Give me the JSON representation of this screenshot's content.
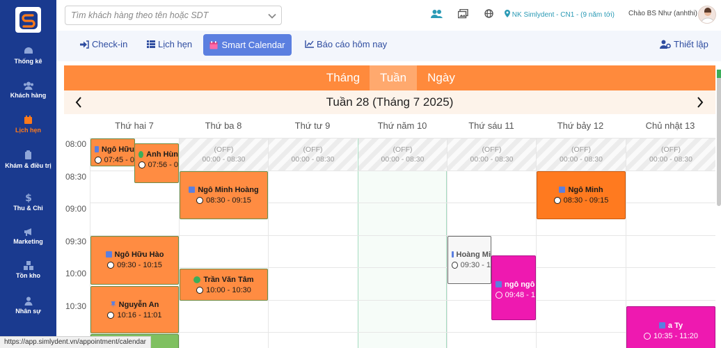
{
  "sidebar": {
    "items": [
      {
        "label": "Thống kê",
        "icon": "dashboard-icon"
      },
      {
        "label": "Khách hàng",
        "icon": "users-icon"
      },
      {
        "label": "Lịch hẹn",
        "icon": "calendar-icon",
        "active": true
      },
      {
        "label": "Khám & điều trị",
        "icon": "clipboard-icon"
      },
      {
        "label": "Thu & Chi",
        "icon": "dollar-icon"
      },
      {
        "label": "Marketing",
        "icon": "megaphone-icon"
      },
      {
        "label": "Tồn kho",
        "icon": "boxes-icon"
      },
      {
        "label": "Nhân sự",
        "icon": "user-icon"
      }
    ]
  },
  "header": {
    "search_placeholder": "Tìm khách hàng theo tên hoặc SDT",
    "branch": "NK Simlydent - CN1 - (9 năm tới)",
    "greeting": "Chào BS Như (anhthi)"
  },
  "nav": {
    "checkin": "Check-in",
    "schedule": "Lịch hẹn",
    "smart_calendar": "Smart Calendar",
    "report": "Báo cáo hôm nay",
    "settings": "Thiết lập"
  },
  "calendar": {
    "views": [
      "Tháng",
      "Tuần",
      "Ngày"
    ],
    "active_view": "Tuần",
    "week_title": "Tuần 28 (Tháng 7 2025)",
    "days": [
      "Thứ hai 7",
      "Thứ ba 8",
      "Thứ tư 9",
      "Thứ năm 10",
      "Thứ sáu 11",
      "Thứ bảy 12",
      "Chủ nhật 13"
    ],
    "times": [
      "08:00",
      "08:30",
      "09:00",
      "09:30",
      "10:00",
      "10:30"
    ],
    "off_label": "(OFF)",
    "off_range": "00:00 - 08:30",
    "appointments": [
      {
        "name": "Ngô Hữu",
        "time": "07:45 - 0",
        "status": "booked"
      },
      {
        "name": "Anh Hùn",
        "time": "07:56 - 0",
        "status": "checked"
      },
      {
        "name": "Ngô Minh Hoàng",
        "time": "08:30 - 09:15",
        "status": "booked"
      },
      {
        "name": "Ngô Minh",
        "time": "08:30 - 09:15",
        "status": "booked"
      },
      {
        "name": "Ngô Hữu Hào",
        "time": "09:30 - 10:15",
        "status": "booked"
      },
      {
        "name": "Hoàng Mi",
        "time": "09:30 - 1",
        "status": "booked"
      },
      {
        "name": "ngô ngô",
        "time": "09:48 - 1",
        "status": "booked"
      },
      {
        "name": "Trần Văn Tâm",
        "time": "10:00 - 10:30",
        "status": "checked"
      },
      {
        "name": "Nguyễn An",
        "time": "10:16 - 11:01",
        "status": "pinned"
      },
      {
        "name": "a Ty",
        "time": "10:35 - 11:20",
        "status": "booked"
      }
    ]
  },
  "status_url": "https://app.simlydent.vn/appointment/calendar",
  "colors": {
    "sidebar": "#1a3a8f",
    "accent_orange": "#ff8a3c",
    "smart_calendar_button": "#5b7fe0",
    "pink_appointment": "#ee19b0"
  }
}
